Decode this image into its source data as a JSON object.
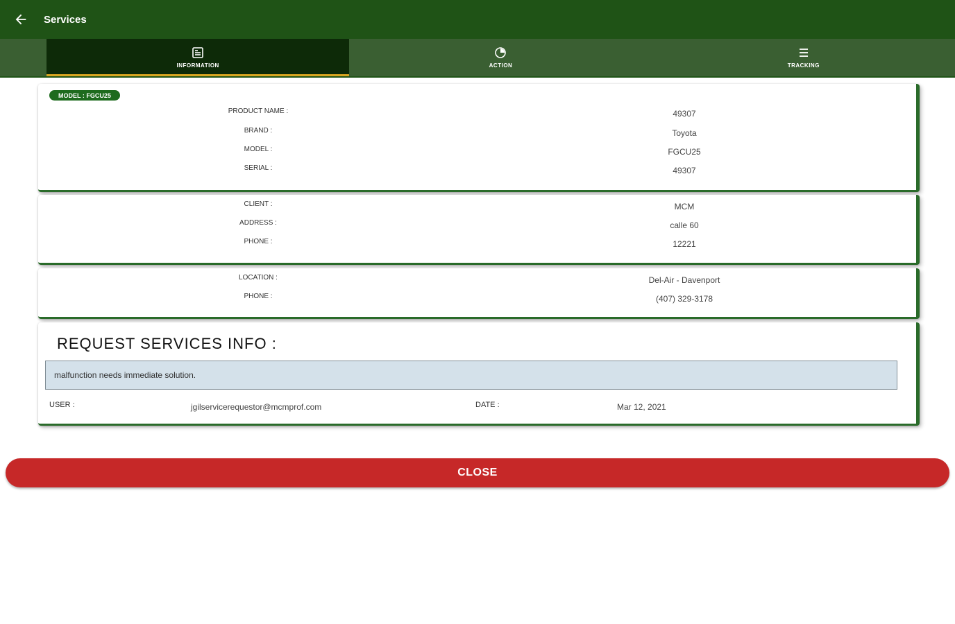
{
  "appbar": {
    "title": "Services",
    "back_icon": "arrow-left-icon"
  },
  "tabs": [
    {
      "label": "INFORMATION",
      "icon": "info-card-icon",
      "active": true
    },
    {
      "label": "ACTION",
      "icon": "action-icon",
      "active": false
    },
    {
      "label": "TRACKING",
      "icon": "list-icon",
      "active": false
    }
  ],
  "equipment": {
    "badge": "MODEL : FGCU25",
    "rows": [
      {
        "label": "PRODUCT NAME :",
        "value": "49307"
      },
      {
        "label": "BRAND :",
        "value": "Toyota"
      },
      {
        "label": "MODEL :",
        "value": "FGCU25"
      },
      {
        "label": "SERIAL :",
        "value": "49307"
      }
    ]
  },
  "client": {
    "rows": [
      {
        "label": "CLIENT :",
        "value": "MCM"
      },
      {
        "label": "ADDRESS :",
        "value": "calle 60"
      },
      {
        "label": "PHONE :",
        "value": "12221"
      }
    ]
  },
  "location": {
    "rows": [
      {
        "label": "LOCATION :",
        "value": "Del-Air - Davenport"
      },
      {
        "label": "PHONE :",
        "value": "(407) 329-3178"
      }
    ]
  },
  "request": {
    "title": "REQUEST SERVICES INFO :",
    "description": "malfunction needs immediate solution.",
    "user_label": "USER :",
    "user_value": "jgilservicerequestor@mcmprof.com",
    "date_label": "DATE :",
    "date_value": "Mar 12, 2021"
  },
  "close_label": "CLOSE",
  "colors": {
    "primary": "#1f5316",
    "tabbar": "#3a5f32",
    "tab_active": "#0d2a08",
    "tab_indicator": "#d9a621",
    "card_accent": "#2a6b2a",
    "close": "#c62828"
  }
}
